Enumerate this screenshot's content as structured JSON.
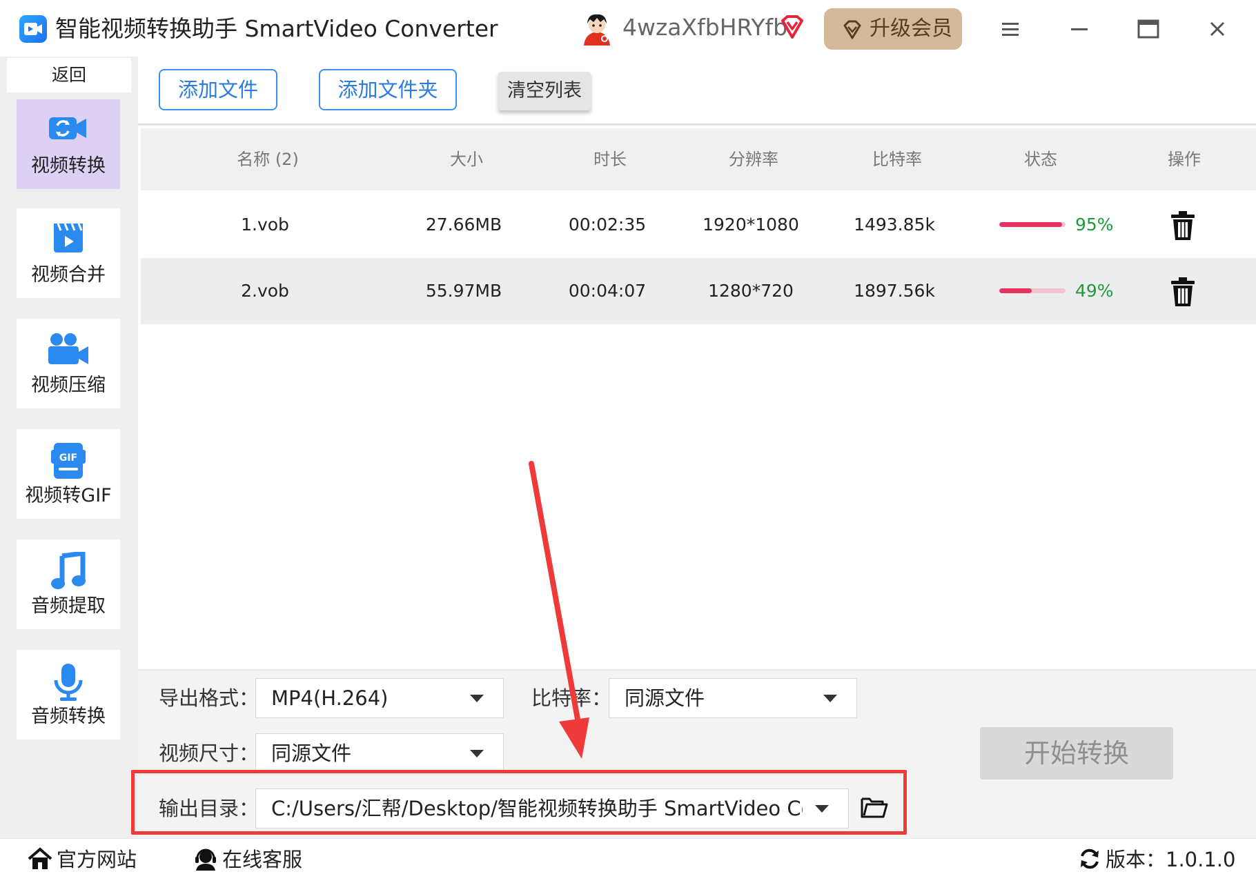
{
  "app": {
    "title": "智能视频转换助手 SmartVideo Converter",
    "username": "4wzaXfbHRYfb",
    "upgrade_label": "升级会员",
    "accent_color": "#3b8ff0",
    "icons": [
      "app-logo-icon",
      "avatar",
      "vip-diamond-icon",
      "menu-icon",
      "minimize-icon",
      "maximize-icon",
      "close-icon"
    ]
  },
  "sidebar": {
    "back_label": "返回",
    "items": [
      {
        "label": "视频转换",
        "icon": "video-convert-icon",
        "active": true
      },
      {
        "label": "视频合并",
        "icon": "video-merge-icon",
        "active": false
      },
      {
        "label": "视频压缩",
        "icon": "video-compress-icon",
        "active": false
      },
      {
        "label": "视频转GIF",
        "icon": "gif-icon",
        "active": false
      },
      {
        "label": "音频提取",
        "icon": "music-note-icon",
        "active": false
      },
      {
        "label": "音频转换",
        "icon": "microphone-icon",
        "active": false
      }
    ]
  },
  "toolbar": {
    "add_file": "添加文件",
    "add_folder": "添加文件夹",
    "clear_list": "清空列表"
  },
  "table": {
    "headers": [
      "名称 (2)",
      "大小",
      "时长",
      "分辨率",
      "比特率",
      "状态",
      "操作"
    ],
    "rows": [
      {
        "name": "1.vob",
        "size": "27.66MB",
        "duration": "00:02:35",
        "resolution": "1920*1080",
        "bitrate": "1493.85k",
        "progress": 0.95,
        "progress_text": "95%"
      },
      {
        "name": "2.vob",
        "size": "55.97MB",
        "duration": "00:04:07",
        "resolution": "1280*720",
        "bitrate": "1897.56k",
        "progress": 0.49,
        "progress_text": "49%"
      }
    ],
    "progress_color": "#e8335f",
    "progress_text_color": "#1f9b3a"
  },
  "settings": {
    "format_label": "导出格式：",
    "format_value": "MP4(H.264)",
    "bitrate_label": "比特率：",
    "bitrate_value": "同源文件",
    "size_label": "视频尺寸：",
    "size_value": "同源文件",
    "output_label": "输出目录：",
    "output_value": "C:/Users/汇帮/Desktop/智能视频转换助手 SmartVideo Cor",
    "start_label": "开始转换"
  },
  "annotation": {
    "highlight_color": "#ee3a3a"
  },
  "footer": {
    "website": "官方网站",
    "support": "在线客服",
    "version": "版本：1.0.1.0"
  }
}
